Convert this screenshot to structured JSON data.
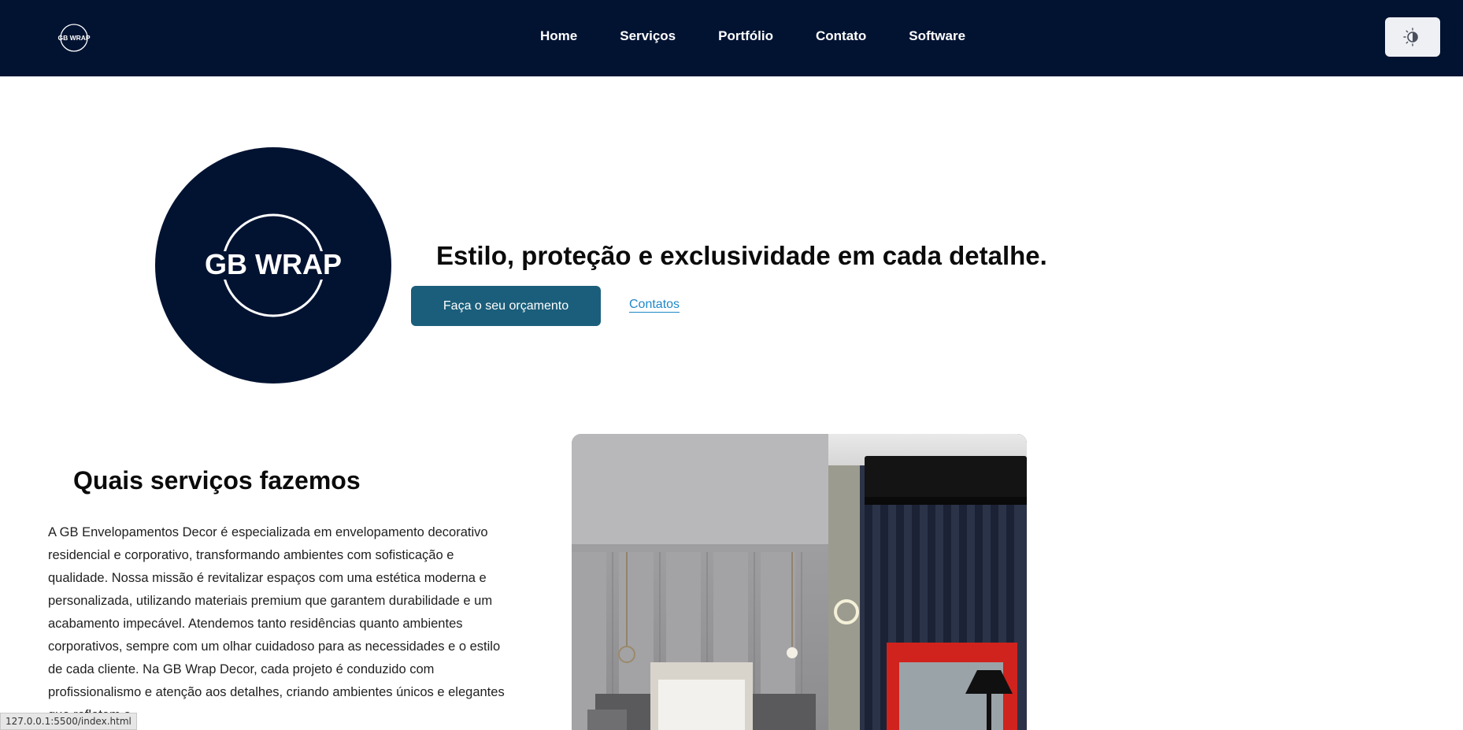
{
  "header": {
    "logo_text": "GB WRAP",
    "nav": [
      {
        "label": "Home"
      },
      {
        "label": "Serviços"
      },
      {
        "label": "Portfólio"
      },
      {
        "label": "Contato"
      },
      {
        "label": "Software"
      }
    ],
    "theme_toggle_icon": "theme-toggle-icon"
  },
  "hero": {
    "logo_text": "GB WRAP",
    "title": "Estilo, proteção e exclusividade em cada detalhe.",
    "cta_label": "Faça o seu orçamento",
    "contacts_label": "Contatos"
  },
  "services": {
    "title": "Quais serviços fazemos",
    "body": "A GB Envelopamentos Decor é especializada em envelopamento decorativo residencial e corporativo, transformando ambientes com sofisticação e qualidade. Nossa missão é revitalizar espaços com uma estética moderna e personalizada, utilizando materiais premium que garantem durabilidade e um acabamento impecável. Atendemos tanto residências quanto ambientes corporativos, sempre com um olhar cuidadoso para as necessidades e o estilo de cada cliente. Na GB Wrap Decor, cada projeto é conduzido com profissionalismo e atenção aos detalhes, criando ambientes únicos e elegantes que refletem a"
  },
  "status_bar": {
    "url": "127.0.0.1:5500/index.html"
  },
  "colors": {
    "navy": "#021332",
    "button": "#1b5e7b",
    "link": "#1e88c8"
  }
}
